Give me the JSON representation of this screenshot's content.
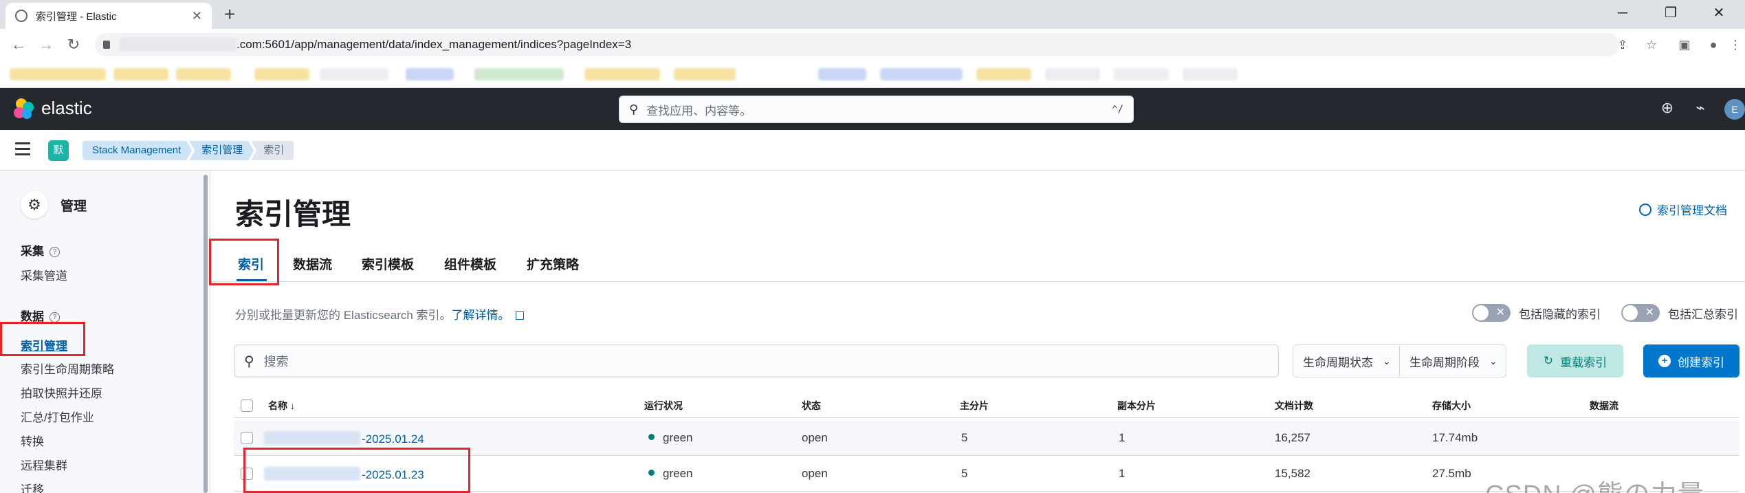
{
  "browser": {
    "tab_title": "索引管理 - Elastic",
    "tab_close": "✕",
    "new_tab": "+",
    "url": ".com:5601/app/management/data/index_management/indices?pageIndex=3",
    "controls": {
      "min": "─",
      "restore": "❐",
      "close": "✕"
    },
    "nav": {
      "back": "←",
      "forward": "→",
      "reload": "↻"
    }
  },
  "kibana": {
    "brand": "elastic",
    "search_placeholder": "查找应用、内容等。",
    "search_shortcut": "⌃/",
    "avatar": "E",
    "space_badge": "默"
  },
  "breadcrumbs": [
    "Stack Management",
    "索引管理",
    "索引"
  ],
  "sidebar": {
    "title": "管理",
    "sections": [
      {
        "label": "采集",
        "items": [
          "采集管道"
        ]
      },
      {
        "label": "数据",
        "items": [
          "索引管理",
          "索引生命周期策略",
          "拍取快照并还原",
          "汇总/打包作业",
          "转换",
          "远程集群",
          "迁移"
        ]
      }
    ],
    "active_item": "索引管理"
  },
  "main": {
    "title": "索引管理",
    "doc_link": "索引管理文档",
    "tabs": [
      "索引",
      "数据流",
      "索引模板",
      "组件模板",
      "扩充策略"
    ],
    "selected_tab": "索引",
    "description": "分别或批量更新您的 Elasticsearch 索引。",
    "learn_more": "了解详情。",
    "toggle_hidden": "包括隐藏的索引",
    "toggle_rollup": "包括汇总索引",
    "search_placeholder": "搜索",
    "filter_lifecycle_status": "生命周期状态",
    "filter_lifecycle_phase": "生命周期阶段",
    "reload_button": "重载索引",
    "create_button": "创建索引"
  },
  "table": {
    "columns": [
      "名称",
      "运行状况",
      "状态",
      "主分片",
      "副本分片",
      "文档计数",
      "存储大小",
      "数据流"
    ],
    "sort_indicator": "↓",
    "rows": [
      {
        "name_suffix": "-2025.01.24",
        "health": "green",
        "status": "open",
        "primaries": "5",
        "replicas": "1",
        "docs": "16,257",
        "size": "17.74mb",
        "data_stream": ""
      },
      {
        "name_suffix": "-2025.01.23",
        "health": "green",
        "status": "open",
        "primaries": "5",
        "replicas": "1",
        "docs": "15,582",
        "size": "27.5mb",
        "data_stream": ""
      }
    ]
  },
  "watermark": "CSDN @熊の力量",
  "colors": {
    "header_bg": "#25282f",
    "link": "#0061a6",
    "primary": "#0077cc",
    "health_green": "#017d73",
    "annotation_red": "#e5252a"
  }
}
